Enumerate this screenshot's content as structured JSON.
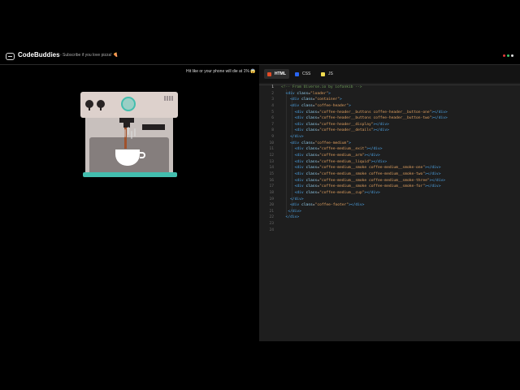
{
  "header": {
    "app_title": "CodeBuddies",
    "tagline": "- Subscribe if you love pizza! 🍕",
    "dot_colors": [
      "#e23b3b",
      "#3ec46d",
      "#e0e0e0"
    ]
  },
  "preview": {
    "note": "Hit like or your phone will die at 1% 😱"
  },
  "machine_colors": {
    "accent": "#43beae",
    "body": "#ddd1cc",
    "coffee": "#a0522d"
  },
  "editor": {
    "tabs": [
      {
        "label": "HTML",
        "icon": "html-icon",
        "color": "#e34c26"
      },
      {
        "label": "CSS",
        "icon": "css-icon",
        "color": "#2965f1"
      },
      {
        "label": "JS",
        "icon": "js-icon",
        "color": "#f0db4f"
      }
    ],
    "lines": [
      {
        "n": "1",
        "html": "<span class='cmt'>&lt;!-- From Uiverse.io by iofankib --&gt;</span>"
      },
      {
        "n": "2",
        "html": "  <span class='tag'>&lt;div</span> <span class='attr'>class</span>=<span class='str'>\"loader\"</span><span class='tag'>&gt;</span>"
      },
      {
        "n": "3",
        "html": "    <span class='tag'>&lt;div</span> <span class='attr'>class</span>=<span class='str'>\"container\"</span><span class='tag'>&gt;</span>"
      },
      {
        "n": "4",
        "html": "    <span class='tag'>&lt;div</span> <span class='attr'>class</span>=<span class='str'>\"coffee-header\"</span><span class='tag'>&gt;</span>"
      },
      {
        "n": "5",
        "html": "      <span class='tag'>&lt;div</span> <span class='attr'>class</span>=<span class='str'>\"coffee-header__buttons coffee-header__button-one\"</span><span class='tag'>&gt;&lt;/div&gt;</span>"
      },
      {
        "n": "6",
        "html": "      <span class='tag'>&lt;div</span> <span class='attr'>class</span>=<span class='str'>\"coffee-header__buttons coffee-header__button-two\"</span><span class='tag'>&gt;&lt;/div&gt;</span>"
      },
      {
        "n": "7",
        "html": "      <span class='tag'>&lt;div</span> <span class='attr'>class</span>=<span class='str'>\"coffee-header__display\"</span><span class='tag'>&gt;&lt;/div&gt;</span>"
      },
      {
        "n": "8",
        "html": "      <span class='tag'>&lt;div</span> <span class='attr'>class</span>=<span class='str'>\"coffee-header__details\"</span><span class='tag'>&gt;&lt;/div&gt;</span>"
      },
      {
        "n": "9",
        "html": "    <span class='tag'>&lt;/div&gt;</span>"
      },
      {
        "n": "10",
        "html": "    <span class='tag'>&lt;div</span> <span class='attr'>class</span>=<span class='str'>\"coffee-medium\"</span><span class='tag'>&gt;</span>"
      },
      {
        "n": "11",
        "html": "      <span class='tag'>&lt;div</span> <span class='attr'>class</span>=<span class='str'>\"coffee-medium__exit\"</span><span class='tag'>&gt;&lt;/div&gt;</span>"
      },
      {
        "n": "12",
        "html": "      <span class='tag'>&lt;div</span> <span class='attr'>class</span>=<span class='str'>\"coffee-medium__arm\"</span><span class='tag'>&gt;&lt;/div&gt;</span>"
      },
      {
        "n": "13",
        "html": "      <span class='tag'>&lt;div</span> <span class='attr'>class</span>=<span class='str'>\"coffee-medium__liquid\"</span><span class='tag'>&gt;&lt;/div&gt;</span>"
      },
      {
        "n": "14",
        "html": "      <span class='tag'>&lt;div</span> <span class='attr'>class</span>=<span class='str'>\"coffee-medium__smoke coffee-medium__smoke-one\"</span><span class='tag'>&gt;&lt;/div&gt;</span>"
      },
      {
        "n": "15",
        "html": "      <span class='tag'>&lt;div</span> <span class='attr'>class</span>=<span class='str'>\"coffee-medium__smoke coffee-medium__smoke-two\"</span><span class='tag'>&gt;&lt;/div&gt;</span>"
      },
      {
        "n": "16",
        "html": "      <span class='tag'>&lt;div</span> <span class='attr'>class</span>=<span class='str'>\"coffee-medium__smoke coffee-medium__smoke-three\"</span><span class='tag'>&gt;&lt;/div&gt;</span>"
      },
      {
        "n": "17",
        "html": "      <span class='tag'>&lt;div</span> <span class='attr'>class</span>=<span class='str'>\"coffee-medium__smoke coffee-medium__smoke-for\"</span><span class='tag'>&gt;&lt;/div&gt;</span>"
      },
      {
        "n": "18",
        "html": "      <span class='tag'>&lt;div</span> <span class='attr'>class</span>=<span class='str'>\"coffee-medium__cup\"</span><span class='tag'>&gt;&lt;/div&gt;</span>"
      },
      {
        "n": "19",
        "html": "    <span class='tag'>&lt;/div&gt;</span>"
      },
      {
        "n": "20",
        "html": "    <span class='tag'>&lt;div</span> <span class='attr'>class</span>=<span class='str'>\"coffee-footer\"</span><span class='tag'>&gt;&lt;/div&gt;</span>"
      },
      {
        "n": "21",
        "html": "   <span class='tag'>&lt;/div&gt;</span>"
      },
      {
        "n": "22",
        "html": "  <span class='tag'>&lt;/div&gt;</span>"
      },
      {
        "n": "23",
        "html": ""
      },
      {
        "n": "24",
        "html": ""
      }
    ]
  }
}
